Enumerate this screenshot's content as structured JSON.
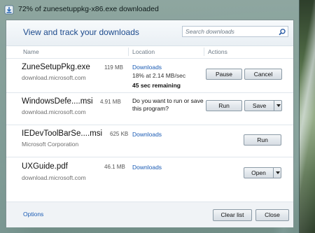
{
  "window": {
    "title": "72% of zunesetuppkg-x86.exe downloaded"
  },
  "header": {
    "title": "View and track your downloads",
    "search_placeholder": "Search downloads"
  },
  "columns": {
    "name": "Name",
    "location": "Location",
    "actions": "Actions"
  },
  "downloads": [
    {
      "name": "ZuneSetupPkg.exe",
      "source": "download.microsoft.com",
      "size": "119 MB",
      "location_link": "Downloads",
      "progress_text": "18% at 2.14 MB/sec",
      "remaining": "45 sec remaining",
      "buttons": [
        "Pause",
        "Cancel"
      ]
    },
    {
      "name": "WindowsDefe....msi",
      "source": "download.microsoft.com",
      "size": "4.91 MB",
      "prompt": "Do you want to run or save this program?",
      "run_label": "Run",
      "save_label": "Save"
    },
    {
      "name": "IEDevToolBarSe....msi",
      "source": "Microsoft Corporation",
      "size": "625 KB",
      "location_link": "Downloads",
      "run_label": "Run"
    },
    {
      "name": "UXGuide.pdf",
      "source": "download.microsoft.com",
      "size": "46.1 MB",
      "location_link": "Downloads",
      "open_label": "Open"
    }
  ],
  "footer": {
    "options": "Options",
    "clear_list": "Clear list",
    "close": "Close"
  },
  "icons": {
    "title": "downloads-window-icon",
    "search": "search-icon",
    "dropdown": "chevron-down-icon"
  }
}
